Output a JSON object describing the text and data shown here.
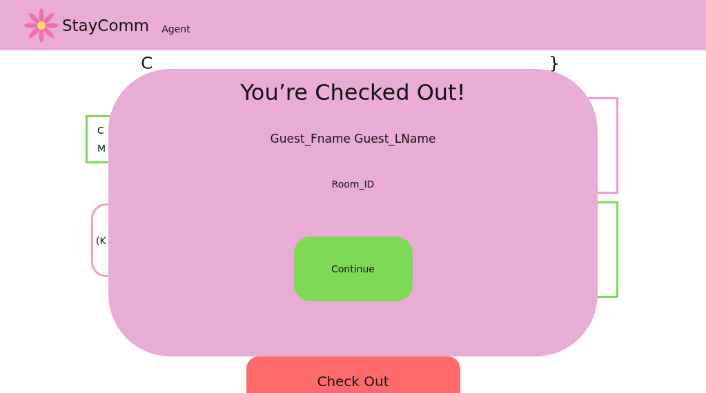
{
  "header": {
    "logo_text": "StayComm",
    "role": "Agent"
  },
  "heading": {
    "start": "C",
    "end": "}"
  },
  "left_cards": [
    {
      "kind": "box",
      "color": "#7ed957",
      "lines": [
        "C",
        "M"
      ]
    },
    {
      "kind": "rounded",
      "color": "#f79ac0",
      "lines": [
        "(K"
      ]
    }
  ],
  "right_cards": [
    {
      "kind": "box",
      "color": "#f09ad0"
    },
    {
      "kind": "box",
      "color": "#7ed957"
    }
  ],
  "check_out_button": "Check Out",
  "modal": {
    "title": "You’re Checked Out!",
    "guest_name": "Guest_Fname Guest_LName",
    "room_id": "Room_ID",
    "continue_button": "Continue"
  }
}
